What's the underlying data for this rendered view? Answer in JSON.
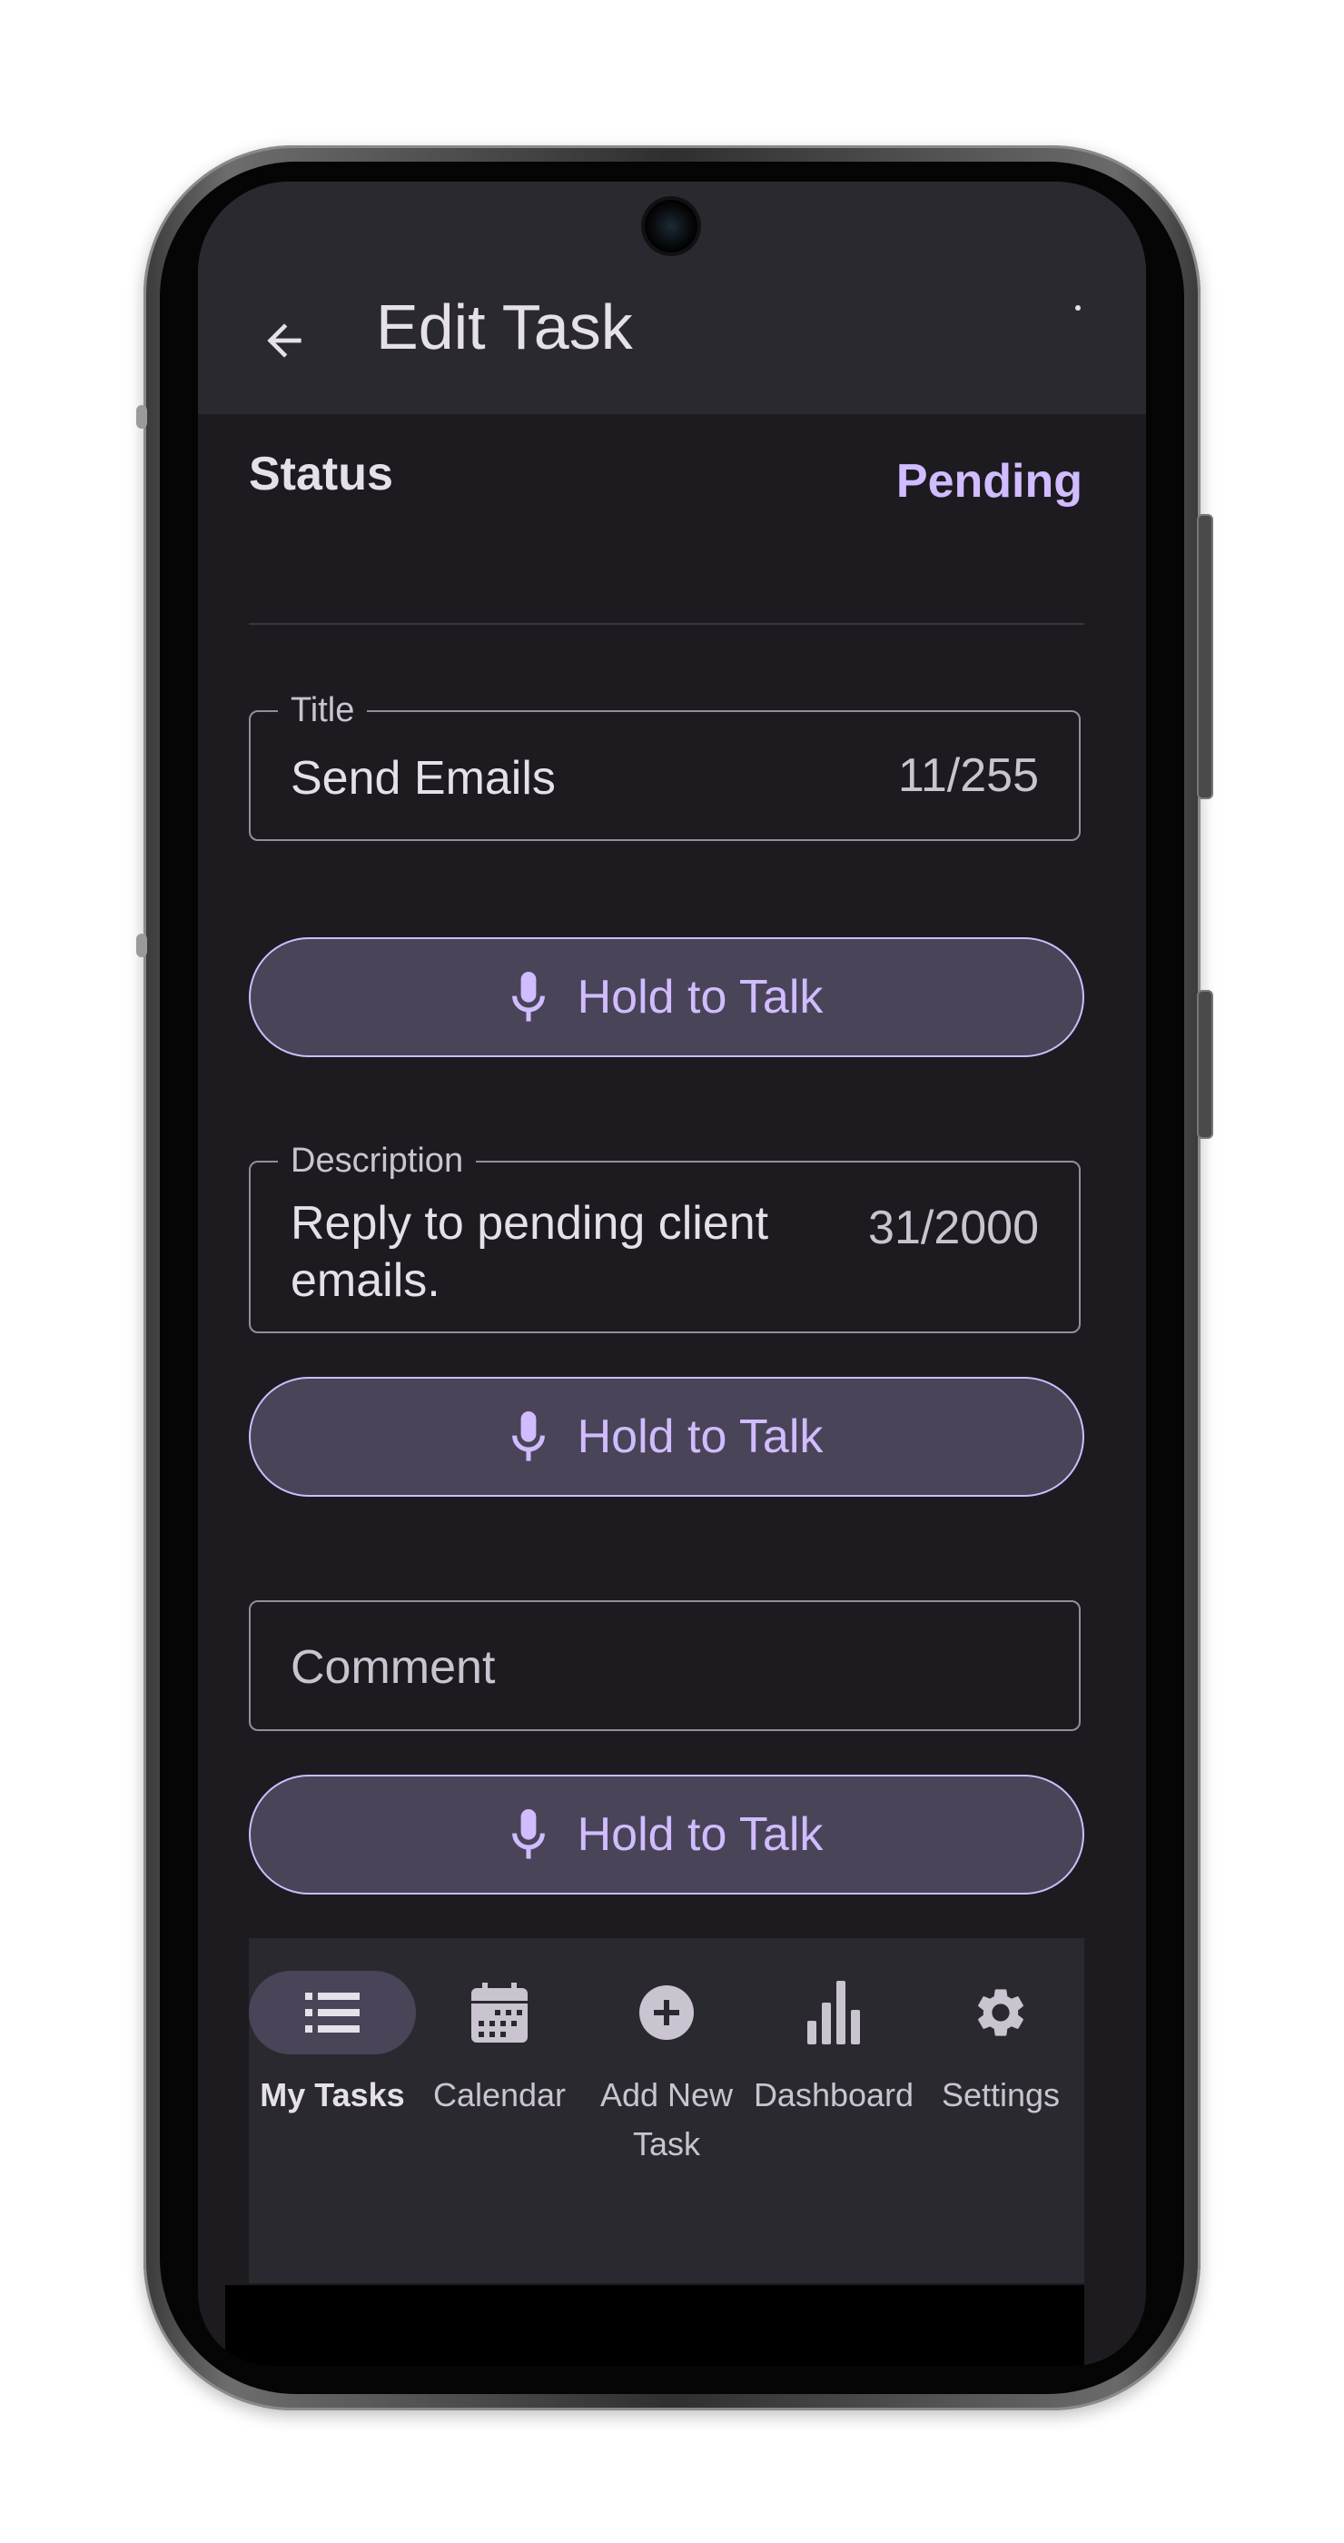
{
  "app_bar": {
    "title": "Edit Task"
  },
  "status": {
    "label": "Status",
    "value": "Pending"
  },
  "title_field": {
    "label": "Title",
    "value": "Send Emails",
    "counter": "11/255"
  },
  "description_field": {
    "label": "Description",
    "value_line1": "Reply to pending client",
    "value_line2": "emails.",
    "counter": "31/2000"
  },
  "comment_field": {
    "placeholder": "Comment"
  },
  "voice_buttons": {
    "title_label": "Hold to Talk",
    "description_label": "Hold to Talk",
    "comment_label": "Hold to Talk"
  },
  "bottom_nav": {
    "items": [
      {
        "label": "My Tasks",
        "icon": "list-icon",
        "active": true
      },
      {
        "label": "Calendar",
        "icon": "calendar-icon",
        "active": false
      },
      {
        "label": "Add New Task",
        "icon": "add-circle-icon",
        "active": false
      },
      {
        "label": "Dashboard",
        "icon": "bar-chart-icon",
        "active": false
      },
      {
        "label": "Settings",
        "icon": "gear-icon",
        "active": false
      }
    ]
  },
  "colors": {
    "background": "#1d1b20",
    "surface": "#2b2930",
    "accent": "#d0bcff",
    "button_fill": "#4a4458",
    "text": "#e6e0e9",
    "muted_text": "#cac4d0"
  }
}
